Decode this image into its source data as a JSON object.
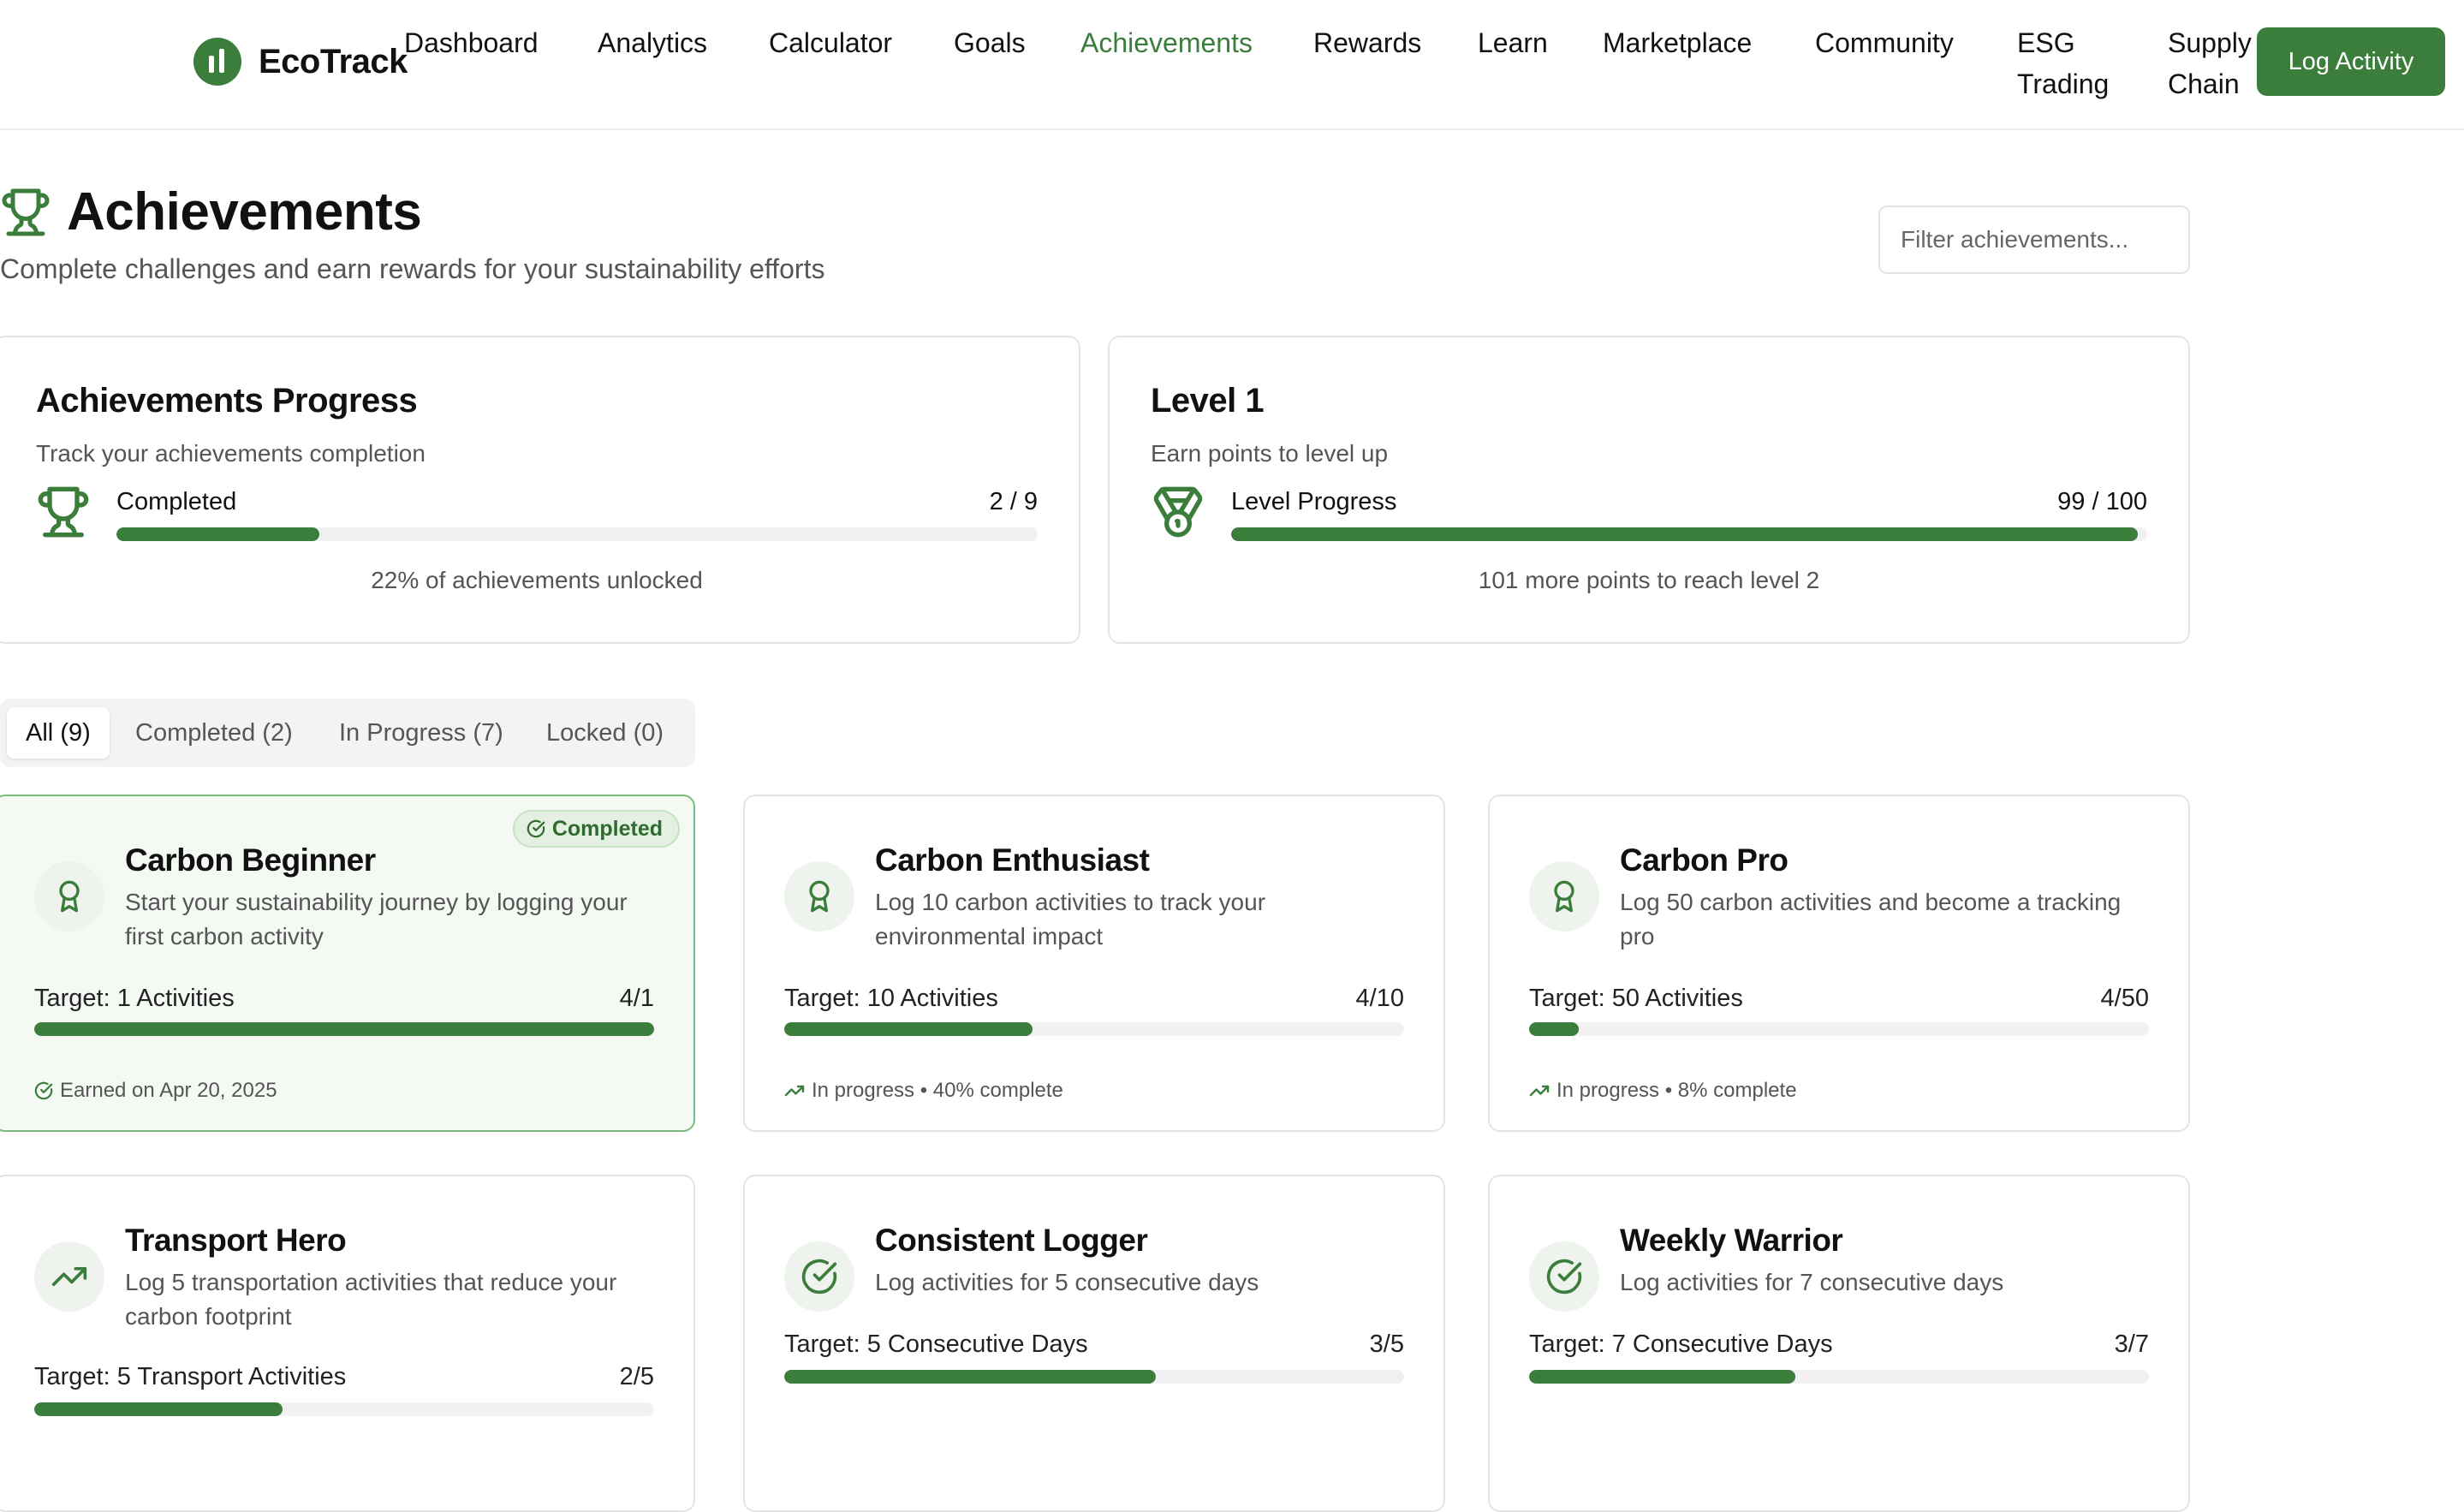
{
  "header": {
    "brand": "EcoTrack",
    "nav": [
      {
        "label": "Dashboard",
        "active": false
      },
      {
        "label": "Analytics",
        "active": false
      },
      {
        "label": "Calculator",
        "active": false
      },
      {
        "label": "Goals",
        "active": false
      },
      {
        "label": "Achievements",
        "active": true
      },
      {
        "label": "Rewards",
        "active": false
      },
      {
        "label": "Learn",
        "active": false
      },
      {
        "label": "Marketplace",
        "active": false
      },
      {
        "label": "Community",
        "active": false
      },
      {
        "label": "ESG Trading",
        "active": false
      },
      {
        "label": "Supply Chain",
        "active": false
      }
    ],
    "cta": "Log Activity"
  },
  "page": {
    "title": "Achievements",
    "subtitle": "Complete challenges and earn rewards for your sustainability efforts",
    "filter_placeholder": "Filter achievements..."
  },
  "progress_card": {
    "title": "Achievements Progress",
    "description": "Track your achievements completion",
    "label": "Completed",
    "value": "2 / 9",
    "fraction": 0.22,
    "note": "22% of achievements unlocked"
  },
  "level_card": {
    "title": "Level 1",
    "description": "Earn points to level up",
    "label": "Level Progress",
    "value": "99 / 100",
    "fraction": 0.99,
    "note": "101 more points to reach level 2"
  },
  "tabs": [
    {
      "label": "All (9)",
      "active": true
    },
    {
      "label": "Completed (2)",
      "active": false
    },
    {
      "label": "In Progress (7)",
      "active": false
    },
    {
      "label": "Locked (0)",
      "active": false
    }
  ],
  "achievements": [
    {
      "title": "Carbon Beginner",
      "description": "Start your sustainability journey by logging your first carbon activity",
      "target": "Target: 1 Activities",
      "count": "4/1",
      "progress": 1.0,
      "status": "Earned on Apr 20, 2025",
      "completed": true,
      "badge": "Completed",
      "icon": "award-icon"
    },
    {
      "title": "Carbon Enthusiast",
      "description": "Log 10 carbon activities to track your environmental impact",
      "target": "Target: 10 Activities",
      "count": "4/10",
      "progress": 0.4,
      "status": "In progress • 40% complete",
      "completed": false,
      "icon": "award-icon"
    },
    {
      "title": "Carbon Pro",
      "description": "Log 50 carbon activities and become a tracking pro",
      "target": "Target: 50 Activities",
      "count": "4/50",
      "progress": 0.08,
      "status": "In progress • 8% complete",
      "completed": false,
      "icon": "award-icon"
    },
    {
      "title": "Transport Hero",
      "description": "Log 5 transportation activities that reduce your carbon footprint",
      "target": "Target: 5 Transport Activities",
      "count": "2/5",
      "progress": 0.4,
      "status": "",
      "completed": false,
      "icon": "trending-up-icon"
    },
    {
      "title": "Consistent Logger",
      "description": "Log activities for 5 consecutive days",
      "target": "Target: 5 Consecutive Days",
      "count": "3/5",
      "progress": 0.6,
      "status": "",
      "completed": false,
      "icon": "check-circle-icon"
    },
    {
      "title": "Weekly Warrior",
      "description": "Log activities for 7 consecutive days",
      "target": "Target: 7 Consecutive Days",
      "count": "3/7",
      "progress": 0.43,
      "status": "",
      "completed": false,
      "icon": "check-circle-icon"
    }
  ],
  "colors": {
    "accent": "#3b7d3b",
    "track": "#f1f1f1",
    "completed_bg": "#f4faf3",
    "completed_border": "#7dbb7d"
  }
}
